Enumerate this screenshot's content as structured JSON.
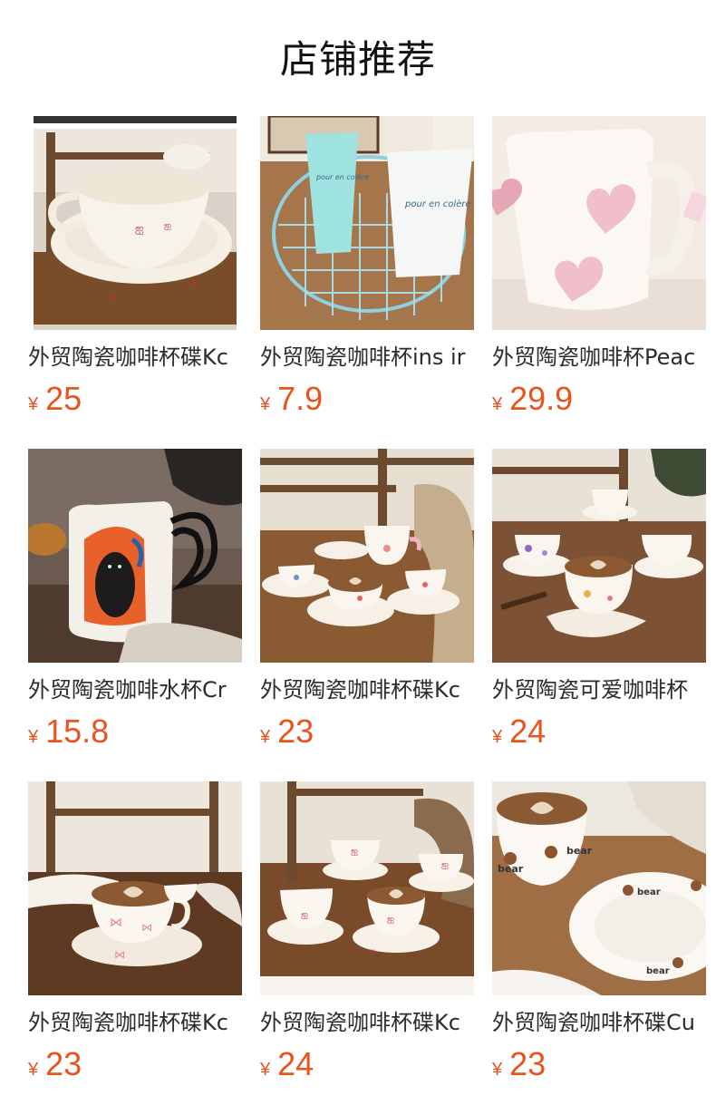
{
  "header": {
    "title": "店铺推荐"
  },
  "currency_symbol": "¥",
  "accent_color": "#e8541b",
  "products": [
    {
      "title": "外贸陶瓷咖啡杯碟Kc",
      "price": "25",
      "image_icon": "cream-cup-saucer-bows-image"
    },
    {
      "title": "外贸陶瓷咖啡杯ins ir",
      "price": "7.9",
      "image_icon": "tumblers-in-basket-image"
    },
    {
      "title": "外贸陶瓷咖啡杯Peac",
      "price": "29.9",
      "image_icon": "heart-mug-image"
    },
    {
      "title": "外贸陶瓷咖啡水杯Cr",
      "price": "15.8",
      "image_icon": "cat-mug-image"
    },
    {
      "title": "外贸陶瓷咖啡杯碟Kc",
      "price": "23",
      "image_icon": "floral-cups-set-image"
    },
    {
      "title": "外贸陶瓷可爱咖啡杯",
      "price": "24",
      "image_icon": "purple-floral-cups-image"
    },
    {
      "title": "外贸陶瓷咖啡杯碟Kc",
      "price": "23",
      "image_icon": "pink-bow-cup-image"
    },
    {
      "title": "外贸陶瓷咖啡杯碟Kc",
      "price": "24",
      "image_icon": "red-bow-cups-set-image"
    },
    {
      "title": "外贸陶瓷咖啡杯碟Cu",
      "price": "23",
      "image_icon": "bear-cup-saucer-image"
    }
  ]
}
